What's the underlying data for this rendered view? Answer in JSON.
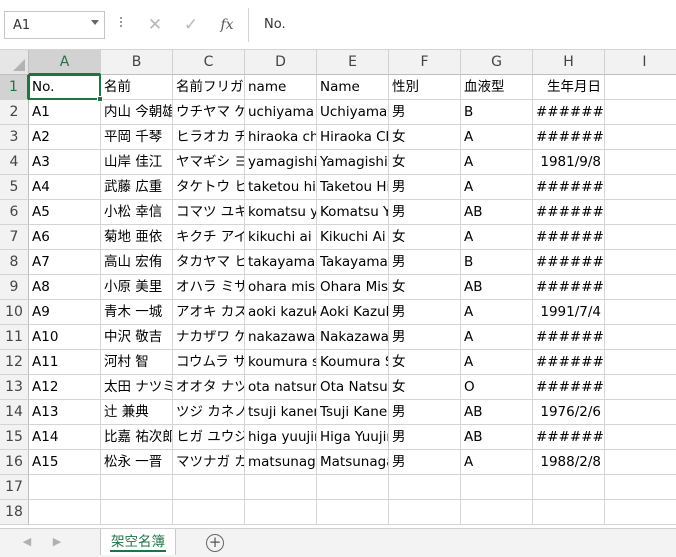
{
  "formula_bar": {
    "name_box": "A1",
    "formula": "No.",
    "cancel_glyph": "✕",
    "enter_glyph": "✓",
    "function_glyph": "fx"
  },
  "grid": {
    "columns": [
      "A",
      "B",
      "C",
      "D",
      "E",
      "F",
      "G",
      "H",
      "I"
    ],
    "row_numbers": [
      "1",
      "2",
      "3",
      "4",
      "5",
      "6",
      "7",
      "8",
      "9",
      "10",
      "11",
      "12",
      "13",
      "14",
      "15",
      "16",
      "17",
      "18"
    ],
    "rows": [
      [
        "No.",
        "名前",
        "名前フリガナ",
        "name",
        "Name",
        "性別",
        "血液型",
        "生年月日",
        ""
      ],
      [
        "A1",
        "内山 今朝雄",
        "ウチヤマ ケサオ",
        "uchiyama kesao",
        "Uchiyama Kesao",
        "男",
        "B",
        "#######",
        ""
      ],
      [
        "A2",
        "平岡 千琴",
        "ヒラオカ チコト",
        "hiraoka chikoto",
        "Hiraoka Chikoto",
        "女",
        "A",
        "#######",
        ""
      ],
      [
        "A3",
        "山岸 佳江",
        "ヤマギシ ヨシエ",
        "yamagishi yoshie",
        "Yamagishi Yoshie",
        "女",
        "A",
        "1981/9/8",
        ""
      ],
      [
        "A4",
        "武藤 広重",
        "タケトウ ヒロシゲ",
        "taketou hiroshige",
        "Taketou Hiroshige",
        "男",
        "A",
        "#######",
        ""
      ],
      [
        "A5",
        "小松 幸信",
        "コマツ ユキノブ",
        "komatsu yukinobu",
        "Komatsu Yukinobu",
        "男",
        "AB",
        "#######",
        ""
      ],
      [
        "A6",
        "菊地 亜依",
        "キクチ アイ",
        "kikuchi ai",
        "Kikuchi Ai",
        "女",
        "A",
        "#######",
        ""
      ],
      [
        "A7",
        "高山 宏侑",
        "タカヤマ ヒロユキ",
        "takayama hiroyuki",
        "Takayama Hiroyuki",
        "男",
        "B",
        "#######",
        ""
      ],
      [
        "A8",
        "小原 美里",
        "オハラ ミサト",
        "ohara misato",
        "Ohara Misato",
        "女",
        "AB",
        "#######",
        ""
      ],
      [
        "A9",
        "青木 一城",
        "アオキ カズキ",
        "aoki kazuki",
        "Aoki Kazuki",
        "男",
        "A",
        "1991/7/4",
        ""
      ],
      [
        "A10",
        "中沢 敬吉",
        "ナカザワ ケイキチ",
        "nakazawa keikichi",
        "Nakazawa Keikichi",
        "男",
        "A",
        "#######",
        ""
      ],
      [
        "A11",
        "河村 智",
        "コウムラ サトシ",
        "koumura satoshi",
        "Koumura Satoshi",
        "女",
        "A",
        "#######",
        ""
      ],
      [
        "A12",
        "太田 ナツミ",
        "オオタ ナツミ",
        "ota natsumi",
        "Ota Natsumi",
        "女",
        "O",
        "#######",
        ""
      ],
      [
        "A13",
        "辻 兼典",
        "ツジ カネノリ",
        "tsuji kanenori",
        "Tsuji Kanenori",
        "男",
        "AB",
        "1976/2/6",
        ""
      ],
      [
        "A14",
        "比嘉 祐次郎",
        "ヒガ ユウジロウ",
        "higa yuujirou",
        "Higa Yuujirou",
        "男",
        "AB",
        "#######",
        ""
      ],
      [
        "A15",
        "松永 一晋",
        "マツナガ カズユキ",
        "matsunaga kazuyuki",
        "Matsunaga Kazuyuki",
        "男",
        "A",
        "1988/2/8",
        ""
      ],
      [
        "",
        "",
        "",
        "",
        "",
        "",
        "",
        "",
        ""
      ],
      [
        "",
        "",
        "",
        "",
        "",
        "",
        "",
        "",
        ""
      ]
    ],
    "right_aligned_cols": [
      7
    ]
  },
  "sheet_tabs": {
    "prev_glyph": "◀",
    "next_glyph": "▶",
    "active_sheet": "架空名簿",
    "add_glyph": "+"
  },
  "colors": {
    "accent": "#217346"
  }
}
